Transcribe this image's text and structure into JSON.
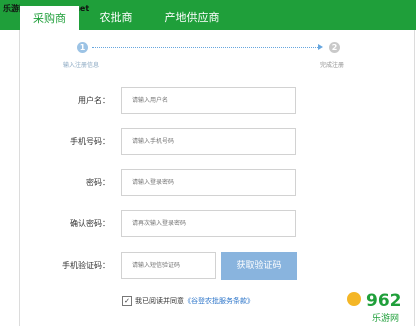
{
  "watermark": "乐游网 www.962.net",
  "tabs": [
    {
      "label": "采购商"
    },
    {
      "label": "农批商"
    },
    {
      "label": "产地供应商"
    }
  ],
  "steps": [
    {
      "number": "1",
      "label": "输入注册信息"
    },
    {
      "number": "2",
      "label": "完成注册"
    }
  ],
  "form": {
    "username": {
      "label": "用户名：",
      "placeholder": "请输入用户名"
    },
    "phone": {
      "label": "手机号码：",
      "placeholder": "请输入手机号码"
    },
    "password": {
      "label": "密码：",
      "placeholder": "请输入登录密码"
    },
    "confirm": {
      "label": "确认密码：",
      "placeholder": "请再次输入登录密码"
    },
    "sms": {
      "label": "手机验证码：",
      "placeholder": "请输入短信验证码",
      "button": "获取验证码"
    }
  },
  "agreement": {
    "check": "✓",
    "text": "我已阅读并同意",
    "link": "《谷登农批服务条款》"
  },
  "logo": {
    "text": "962",
    "sub": "乐游网",
    "color": "#1f9f3a"
  }
}
